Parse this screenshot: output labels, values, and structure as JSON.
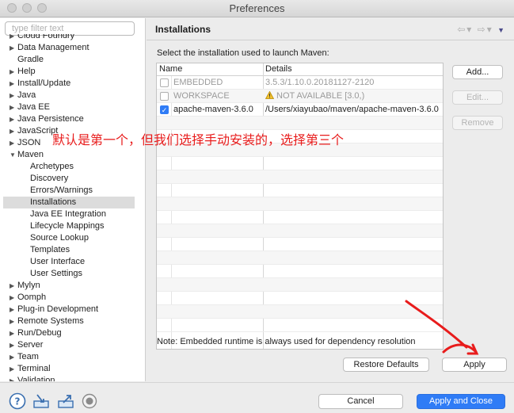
{
  "window": {
    "title": "Preferences"
  },
  "sidebar": {
    "filter_placeholder": "type filter text",
    "items": [
      {
        "label": "Cloud Foundry",
        "level": 0,
        "arrow": "▶"
      },
      {
        "label": "Data Management",
        "level": 0,
        "arrow": "▶"
      },
      {
        "label": "Gradle",
        "level": 0,
        "arrow": ""
      },
      {
        "label": "Help",
        "level": 0,
        "arrow": "▶"
      },
      {
        "label": "Install/Update",
        "level": 0,
        "arrow": "▶"
      },
      {
        "label": "Java",
        "level": 0,
        "arrow": "▶"
      },
      {
        "label": "Java EE",
        "level": 0,
        "arrow": "▶"
      },
      {
        "label": "Java Persistence",
        "level": 0,
        "arrow": "▶"
      },
      {
        "label": "JavaScript",
        "level": 0,
        "arrow": "▶"
      },
      {
        "label": "JSON",
        "level": 0,
        "arrow": "▶"
      },
      {
        "label": "Maven",
        "level": 0,
        "arrow": "▼"
      },
      {
        "label": "Archetypes",
        "level": 1,
        "arrow": ""
      },
      {
        "label": "Discovery",
        "level": 1,
        "arrow": ""
      },
      {
        "label": "Errors/Warnings",
        "level": 1,
        "arrow": ""
      },
      {
        "label": "Installations",
        "level": 1,
        "arrow": "",
        "selected": true
      },
      {
        "label": "Java EE Integration",
        "level": 1,
        "arrow": ""
      },
      {
        "label": "Lifecycle Mappings",
        "level": 1,
        "arrow": ""
      },
      {
        "label": "Source Lookup",
        "level": 1,
        "arrow": ""
      },
      {
        "label": "Templates",
        "level": 1,
        "arrow": ""
      },
      {
        "label": "User Interface",
        "level": 1,
        "arrow": ""
      },
      {
        "label": "User Settings",
        "level": 1,
        "arrow": ""
      },
      {
        "label": "Mylyn",
        "level": 0,
        "arrow": "▶"
      },
      {
        "label": "Oomph",
        "level": 0,
        "arrow": "▶"
      },
      {
        "label": "Plug-in Development",
        "level": 0,
        "arrow": "▶"
      },
      {
        "label": "Remote Systems",
        "level": 0,
        "arrow": "▶"
      },
      {
        "label": "Run/Debug",
        "level": 0,
        "arrow": "▶"
      },
      {
        "label": "Server",
        "level": 0,
        "arrow": "▶"
      },
      {
        "label": "Team",
        "level": 0,
        "arrow": "▶"
      },
      {
        "label": "Terminal",
        "level": 0,
        "arrow": "▶"
      },
      {
        "label": "Validation",
        "level": 0,
        "arrow": "▶"
      }
    ]
  },
  "page": {
    "title": "Installations",
    "prompt": "Select the installation used to launch Maven:",
    "columns": {
      "name": "Name",
      "details": "Details"
    },
    "rows": [
      {
        "name": "EMBEDDED",
        "details": "3.5.3/1.10.0.20181127-2120",
        "checked": false,
        "muted": true,
        "warning": false
      },
      {
        "name": "WORKSPACE",
        "details": "NOT AVAILABLE [3.0,)",
        "checked": false,
        "muted": true,
        "warning": true
      },
      {
        "name": "apache-maven-3.6.0",
        "details": "/Users/xiayubao/maven/apache-maven-3.6.0",
        "checked": true,
        "muted": false,
        "warning": false
      }
    ],
    "empty_rows": 16,
    "buttons": {
      "add": "Add...",
      "edit": "Edit...",
      "remove": "Remove"
    },
    "note": "Note: Embedded runtime is always used for dependency resolution",
    "restore_defaults": "Restore Defaults",
    "apply": "Apply"
  },
  "annotation": {
    "text": "默认是第一个，但我们选择手动安装的，选择第三个",
    "color": "#e81c1c"
  },
  "footer": {
    "cancel": "Cancel",
    "apply_and_close": "Apply and Close"
  },
  "colors": {
    "accent": "#2f7cf6",
    "annotation": "#e81c1c"
  }
}
